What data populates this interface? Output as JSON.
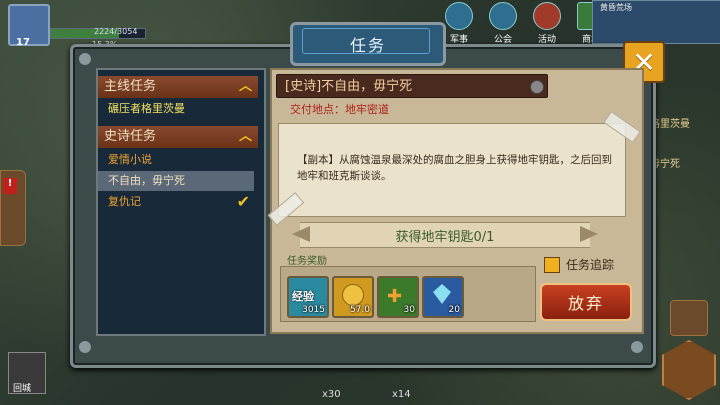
{
  "hud": {
    "level": "17",
    "exp_text": "2224/3054",
    "exp_fraction": 0.728,
    "exp_percent": "15.3%"
  },
  "top_menu": [
    {
      "label": "军事",
      "icon": "helmet-icon"
    },
    {
      "label": "公会",
      "icon": "guild-icon"
    },
    {
      "label": "活动",
      "icon": "gift-icon"
    },
    {
      "label": "商城",
      "icon": "shop-icon"
    }
  ],
  "minimap_title": "黄昏荒场",
  "right_side_texts": [
    "格里茨曼",
    "毋宁死"
  ],
  "dialog": {
    "title": "任务",
    "categories": [
      {
        "label": "主线任务",
        "items": [
          {
            "label": "碾压者格里茨曼"
          }
        ]
      },
      {
        "label": "史诗任务",
        "items": [
          {
            "label": "爱情小说"
          },
          {
            "label": "不自由，毋宁死"
          },
          {
            "label": "复仇记"
          }
        ]
      }
    ],
    "quest": {
      "title": "[史诗]不自由，毋宁死",
      "location": "交付地点：地牢密道",
      "description": "【副本】从腐蚀温泉最深处的腐血之胆身上获得地牢钥匙，之后回到地牢和班克斯谈谈。",
      "objective": "获得地牢钥匙0/1",
      "track_label": "任务追踪",
      "reward_label": "任务奖励",
      "rewards": [
        {
          "name": "经验",
          "amount": "3015",
          "icon": "exp-icon",
          "color": "#2a8aa0"
        },
        {
          "name": "",
          "amount": "57.0",
          "icon": "gold-coins-icon",
          "color": "#d09a20"
        },
        {
          "name": "",
          "amount": "30",
          "icon": "wrench-icon",
          "color": "#3a7a2a"
        },
        {
          "name": "",
          "amount": "20",
          "icon": "crystal-icon",
          "color": "#2a5aa0"
        }
      ],
      "abandon_label": "放弃"
    }
  },
  "bottom": {
    "left_label": "回城",
    "count_a": "x30",
    "count_b": "x14"
  }
}
